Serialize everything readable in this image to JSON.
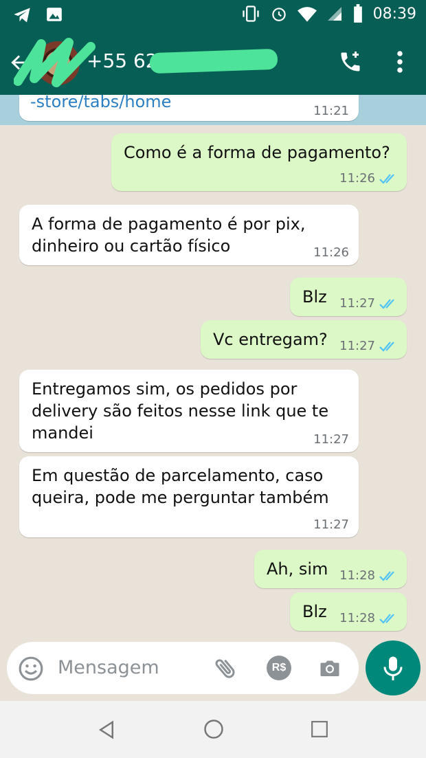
{
  "status_bar": {
    "time": "08:39",
    "icons": [
      "telegram-icon",
      "gallery-icon",
      "vibrate-icon",
      "alarm-icon",
      "wifi-icon",
      "signal-icon",
      "battery-icon"
    ]
  },
  "header": {
    "contact_name": "+55 62",
    "icons": [
      "back-arrow-icon",
      "add-call-icon",
      "more-vert-icon"
    ]
  },
  "messages": [
    {
      "direction": "in",
      "text": "-store/tabs/home",
      "time": "11:21",
      "link": true
    },
    {
      "direction": "out",
      "text": "Como é a forma de pagamento?",
      "time": "11:26"
    },
    {
      "direction": "in",
      "text": "A forma de pagamento é por pix,\ndinheiro ou cartão físico",
      "time": "11:26"
    },
    {
      "direction": "out",
      "text": "Blz",
      "time": "11:27"
    },
    {
      "direction": "out",
      "text": "Vc entregam?",
      "time": "11:27"
    },
    {
      "direction": "in",
      "text": "Entregamos sim, os pedidos por\ndelivery são feitos nesse link que te\nmandei",
      "time": "11:27"
    },
    {
      "direction": "in",
      "text": "Em questão de parcelamento, caso\nqueira, pode me perguntar também",
      "time": "11:27"
    },
    {
      "direction": "out",
      "text": "Ah, sim",
      "time": "11:28"
    },
    {
      "direction": "out",
      "text": "Blz",
      "time": "11:28"
    }
  ],
  "composer": {
    "placeholder": "Mensagem",
    "pay_label": "R$",
    "icons": [
      "emoji-icon",
      "attach-icon",
      "payment-icon",
      "camera-icon",
      "mic-icon"
    ]
  },
  "colors": {
    "header": "#075e54",
    "outgoing_bubble": "#dcf8c6",
    "incoming_bubble": "#ffffff",
    "read_ticks": "#4fc3f7",
    "mic_button": "#00897b"
  }
}
